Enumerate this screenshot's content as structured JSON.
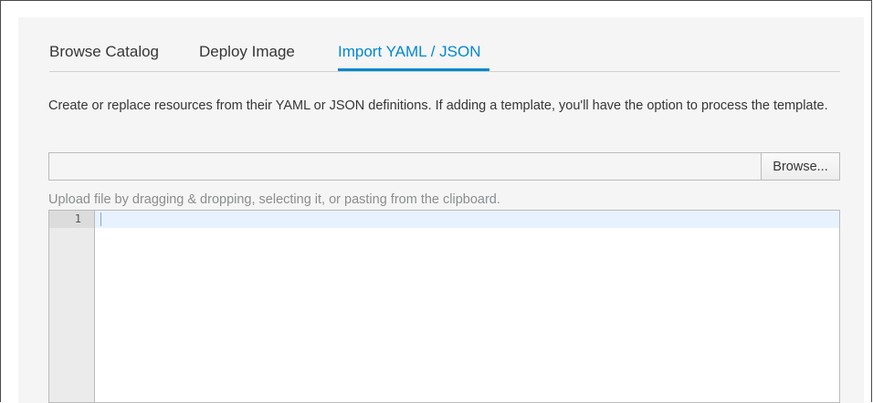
{
  "tabs": [
    {
      "label": "Browse Catalog",
      "active": false
    },
    {
      "label": "Deploy Image",
      "active": false
    },
    {
      "label": "Import YAML / JSON",
      "active": true
    }
  ],
  "description": "Create or replace resources from their YAML or JSON definitions. If adding a template, you'll have the option to process the template.",
  "file_input": {
    "value": "",
    "placeholder": "",
    "browse_label": "Browse..."
  },
  "hint": "Upload file by dragging & dropping, selecting it, or pasting from the clipboard.",
  "editor": {
    "line_numbers": [
      "1"
    ],
    "content": ""
  },
  "colors": {
    "accent": "#0088ce",
    "panel_background": "#f5f5f5",
    "active_line": "#e8f2fe"
  }
}
